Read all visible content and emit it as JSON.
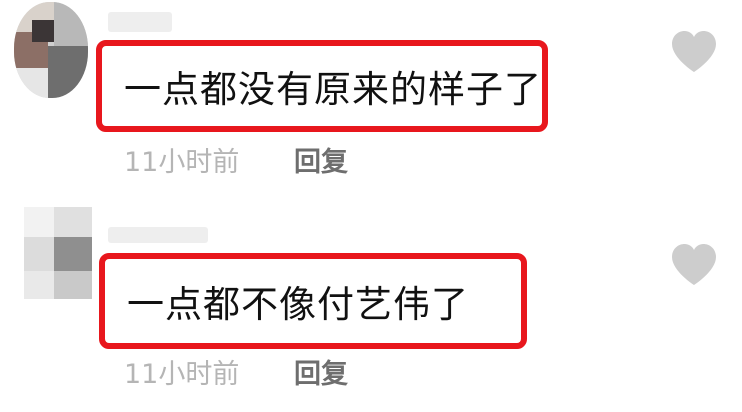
{
  "comments": [
    {
      "text": "一点都没有原来的样子了",
      "time": "11小时前",
      "reply_label": "回复",
      "like_icon": "heart-icon"
    },
    {
      "text": "一点都不像付艺伟了",
      "time": "11小时前",
      "reply_label": "回复",
      "like_icon": "heart-icon"
    }
  ],
  "colors": {
    "highlight_border": "#e8171d",
    "heart": "#cdcdcd",
    "time_text": "#b5b5b5",
    "reply_text": "#6e6e6e"
  }
}
